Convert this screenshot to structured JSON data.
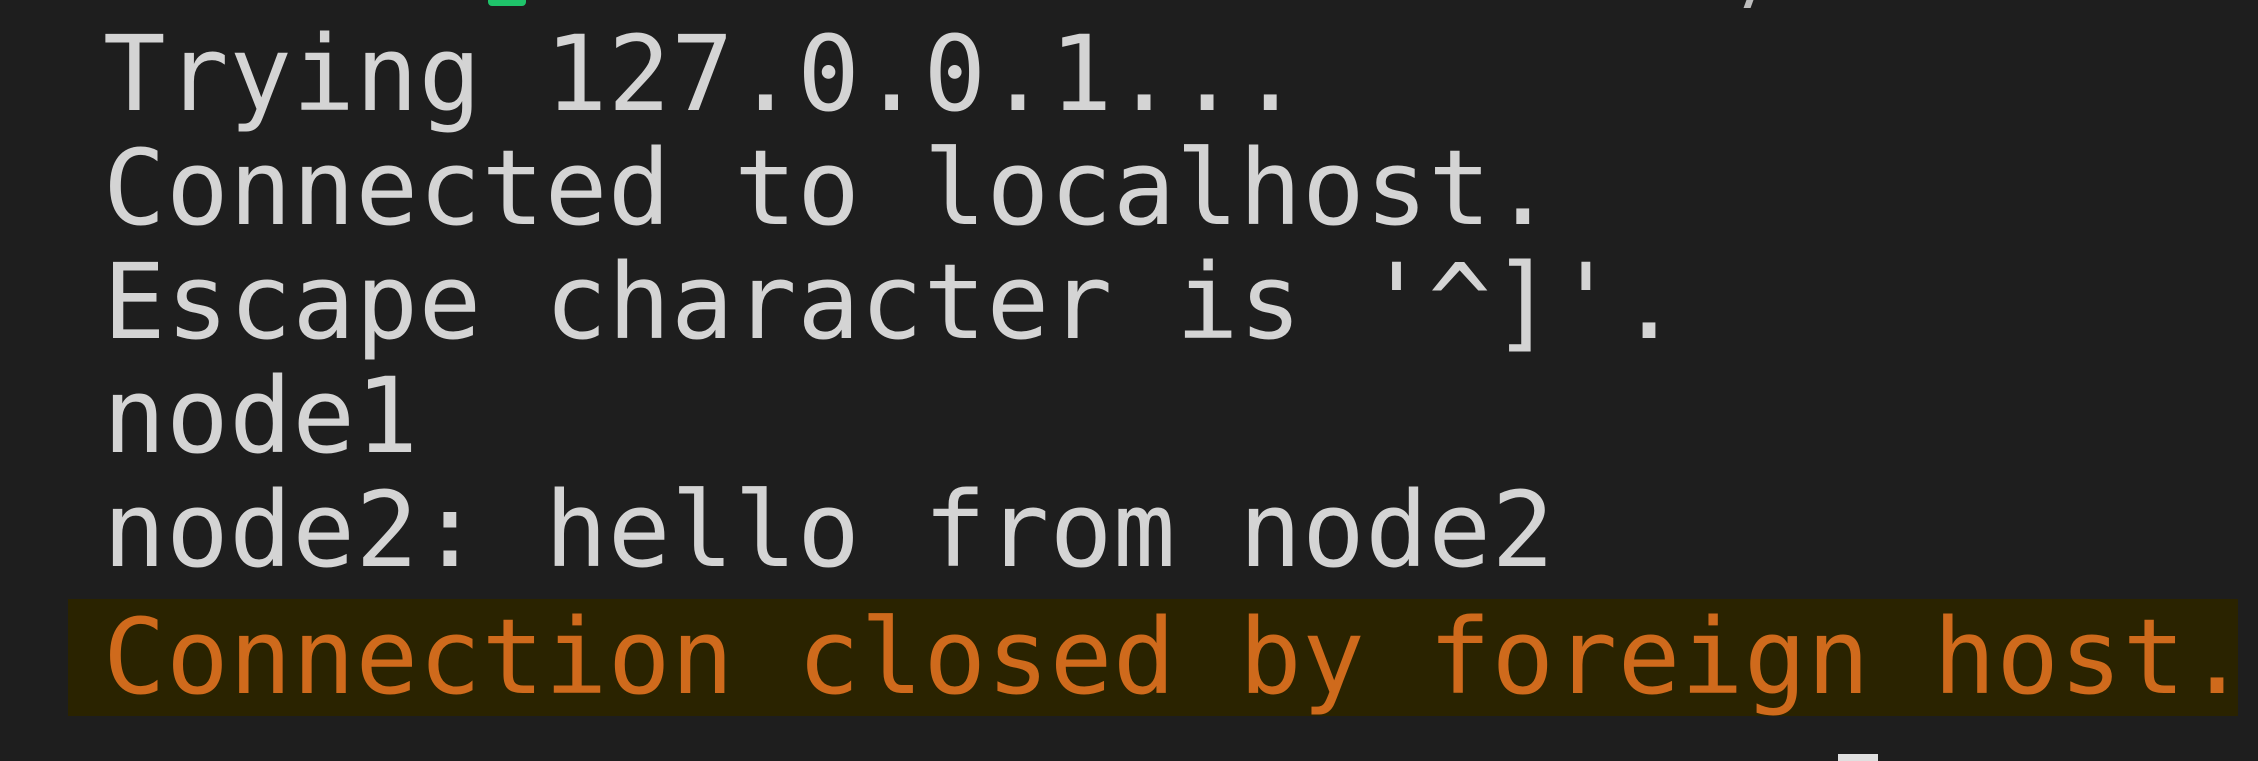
{
  "terminal": {
    "lines": [
      "Trying 127.0.0.1...",
      "Connected to localhost.",
      "Escape character is '^]'.",
      "node1",
      "node2: hello from node2"
    ],
    "closing_message": "Connection closed by foreign host."
  },
  "colors": {
    "background": "#1e1e1e",
    "text": "#d4d4d4",
    "warning_text": "#cf6a1c",
    "warning_highlight": "#2a2300",
    "accent_green": "#1fc36a"
  }
}
